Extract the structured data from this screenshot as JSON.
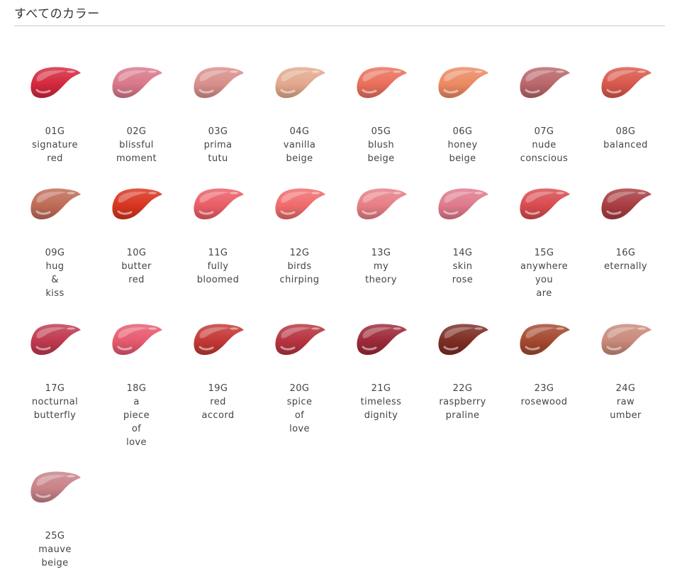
{
  "section": {
    "title": "すべてのカラー"
  },
  "colors": [
    {
      "code": "01G",
      "name": [
        "signature",
        "red"
      ],
      "color": "#d4283d"
    },
    {
      "code": "02G",
      "name": [
        "blissful",
        "moment"
      ],
      "color": "#d9788a"
    },
    {
      "code": "03G",
      "name": [
        "prima",
        "tutu"
      ],
      "color": "#d98f8c"
    },
    {
      "code": "04G",
      "name": [
        "vanilla",
        "beige"
      ],
      "color": "#e3a98e"
    },
    {
      "code": "05G",
      "name": [
        "blush",
        "beige"
      ],
      "color": "#e9705b"
    },
    {
      "code": "06G",
      "name": [
        "honey",
        "beige"
      ],
      "color": "#ec8a63"
    },
    {
      "code": "07G",
      "name": [
        "nude",
        "conscious"
      ],
      "color": "#b9676a"
    },
    {
      "code": "08G",
      "name": [
        "balanced"
      ],
      "color": "#d9584c"
    },
    {
      "code": "09G",
      "name": [
        "hug",
        "&",
        "kiss"
      ],
      "color": "#bf6c57"
    },
    {
      "code": "10G",
      "name": [
        "butter",
        "red"
      ],
      "color": "#d8351f"
    },
    {
      "code": "11G",
      "name": [
        "fully",
        "bloomed"
      ],
      "color": "#ea5e67"
    },
    {
      "code": "12G",
      "name": [
        "birds",
        "chirping"
      ],
      "color": "#f06c6c"
    },
    {
      "code": "13G",
      "name": [
        "my",
        "theory"
      ],
      "color": "#e77f85"
    },
    {
      "code": "14G",
      "name": [
        "skin",
        "rose"
      ],
      "color": "#df7a8b"
    },
    {
      "code": "15G",
      "name": [
        "anywhere",
        "you",
        "are"
      ],
      "color": "#d94b50"
    },
    {
      "code": "16G",
      "name": [
        "eternally"
      ],
      "color": "#a83d42"
    },
    {
      "code": "17G",
      "name": [
        "nocturnal",
        "butterfly"
      ],
      "color": "#c0394f"
    },
    {
      "code": "18G",
      "name": [
        "a",
        "piece",
        "of",
        "love"
      ],
      "color": "#e65a6f"
    },
    {
      "code": "19G",
      "name": [
        "red",
        "accord"
      ],
      "color": "#c33835"
    },
    {
      "code": "20G",
      "name": [
        "spice",
        "of",
        "love"
      ],
      "color": "#b73340"
    },
    {
      "code": "21G",
      "name": [
        "timeless",
        "dignity"
      ],
      "color": "#9c2a39"
    },
    {
      "code": "22G",
      "name": [
        "raspberry",
        "praline"
      ],
      "color": "#7d2d24"
    },
    {
      "code": "23G",
      "name": [
        "rosewood"
      ],
      "color": "#a4492f"
    },
    {
      "code": "24G",
      "name": [
        "raw",
        "umber"
      ],
      "color": "#c98a7a"
    },
    {
      "code": "25G",
      "name": [
        "mauve",
        "beige"
      ],
      "color": "#c88288"
    }
  ]
}
